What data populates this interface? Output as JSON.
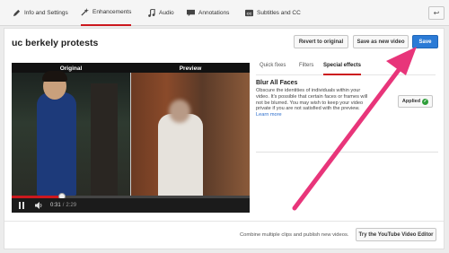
{
  "tabs": [
    {
      "label": "Info and Settings",
      "icon": "pencil-icon"
    },
    {
      "label": "Enhancements",
      "icon": "magic-wand-icon"
    },
    {
      "label": "Audio",
      "icon": "music-note-icon"
    },
    {
      "label": "Annotations",
      "icon": "speech-bubble-icon"
    },
    {
      "label": "Subtitles and CC",
      "icon": "cc-icon"
    }
  ],
  "back_label": "↩",
  "video_title": "uc berkely protests",
  "buttons": {
    "revert": "Revert to original",
    "save_as_new": "Save as new video",
    "save": "Save"
  },
  "player": {
    "original_label": "Original",
    "preview_label": "Preview",
    "time_current": "0:31",
    "time_total": "2:29",
    "progress": 0.21
  },
  "subtabs": [
    "Quick fixes",
    "Filters",
    "Special effects"
  ],
  "effect": {
    "title": "Blur All Faces",
    "description": "Obscure the identities of individuals within your video. It's possible that certain faces or frames will not be blurred. You may wish to keep your video private if you are not satisfied with the preview.",
    "learn_more": "Learn more",
    "applied_label": "Applied"
  },
  "footer": {
    "combine_text": "Combine multiple clips and publish new videos.",
    "try_editor": "Try the YouTube Video Editor"
  },
  "colors": {
    "accent": "#cc181e",
    "save_blue": "#2b7bd6",
    "arrow": "#e8357a"
  }
}
